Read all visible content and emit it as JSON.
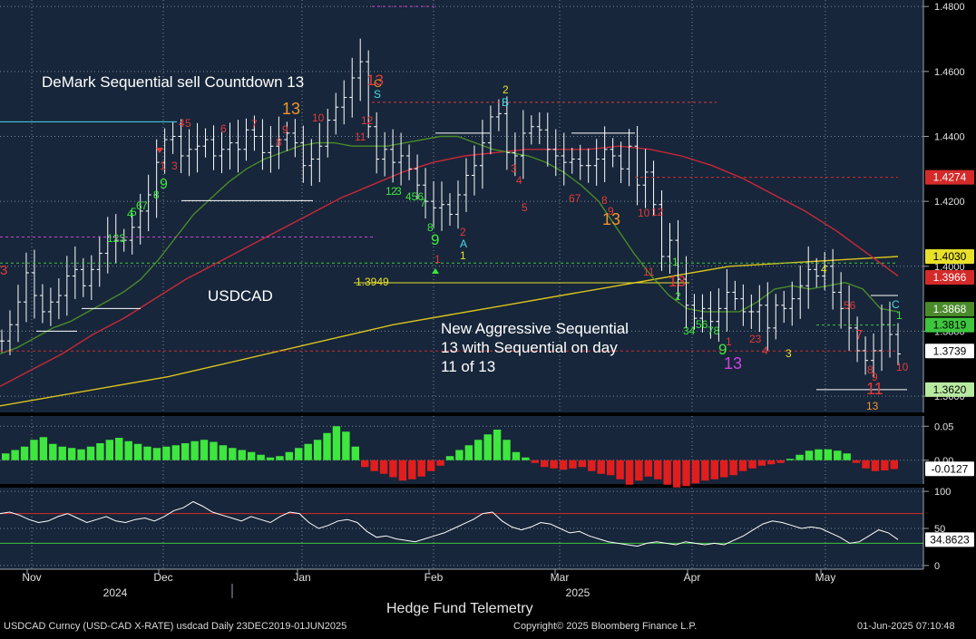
{
  "chart_data": {
    "type": "line",
    "title": "USDCAD",
    "security": "USDCAD",
    "period": "Daily",
    "x_labels": [
      "Nov",
      "Dec",
      "Jan",
      "Feb",
      "Mar",
      "Apr",
      "May"
    ],
    "year_labels": [
      "2024",
      "2025"
    ],
    "price_panel": {
      "ylim": [
        1.355,
        1.482
      ],
      "y_ticks": [
        "1.4800",
        "1.4600",
        "1.4400",
        "1.4200",
        "1.4000",
        "1.3800",
        "1.3600"
      ],
      "close": [
        1.377,
        1.382,
        1.389,
        1.398,
        1.391,
        1.386,
        1.389,
        1.391,
        1.397,
        1.399,
        1.394,
        1.399,
        1.404,
        1.409,
        1.408,
        1.408,
        1.412,
        1.417,
        1.422,
        1.432,
        1.439,
        1.44,
        1.434,
        1.436,
        1.437,
        1.439,
        1.434,
        1.436,
        1.438,
        1.436,
        1.442,
        1.44,
        1.435,
        1.437,
        1.439,
        1.441,
        1.438,
        1.431,
        1.433,
        1.437,
        1.445,
        1.449,
        1.452,
        1.458,
        1.463,
        1.443,
        1.433,
        1.436,
        1.432,
        1.434,
        1.43,
        1.425,
        1.42,
        1.418,
        1.419,
        1.416,
        1.422,
        1.428,
        1.431,
        1.438,
        1.446,
        1.447,
        1.435,
        1.434,
        1.441,
        1.443,
        1.442,
        1.436,
        1.434,
        1.432,
        1.433,
        1.431,
        1.431,
        1.433,
        1.436,
        1.434,
        1.43,
        1.437,
        1.425,
        1.429,
        1.419,
        1.403,
        1.408,
        1.396,
        1.388,
        1.384,
        1.387,
        1.383,
        1.387,
        1.392,
        1.39,
        1.386,
        1.386,
        1.388,
        1.381,
        1.388,
        1.387,
        1.39,
        1.394,
        1.399,
        1.397,
        1.4,
        1.392,
        1.387,
        1.381,
        1.374,
        1.371,
        1.374,
        1.382,
        1.379,
        1.373
      ],
      "ma_fast": [
        1.373,
        1.375,
        1.378,
        1.381,
        1.383,
        1.386,
        1.389,
        1.392,
        1.396,
        1.402,
        1.409,
        1.416,
        1.421,
        1.426,
        1.43,
        1.433,
        1.435,
        1.437,
        1.438,
        1.438,
        1.437,
        1.437,
        1.437,
        1.438,
        1.439,
        1.44,
        1.44,
        1.438,
        1.436,
        1.435,
        1.434,
        1.432,
        1.429,
        1.425,
        1.42,
        1.412,
        1.404,
        1.397,
        1.391,
        1.387,
        1.386,
        1.386,
        1.386,
        1.389,
        1.393,
        1.394,
        1.393,
        1.394,
        1.395,
        1.393,
        1.387,
        1.386
      ],
      "ma_mid": [
        1.363,
        1.368,
        1.373,
        1.379,
        1.384,
        1.39,
        1.396,
        1.401,
        1.406,
        1.411,
        1.416,
        1.421,
        1.425,
        1.429,
        1.432,
        1.434,
        1.435,
        1.436,
        1.436,
        1.436,
        1.437,
        1.436,
        1.434,
        1.431,
        1.427,
        1.422,
        1.417,
        1.411,
        1.404,
        1.397
      ],
      "ma_slow": [
        1.357,
        1.36,
        1.363,
        1.366,
        1.37,
        1.374,
        1.378,
        1.382,
        1.385,
        1.388,
        1.391,
        1.394,
        1.397,
        1.4,
        1.401,
        1.402,
        1.403
      ],
      "price_labels": [
        {
          "text": "1.4274",
          "value": 1.4274,
          "color": "#d42a2a"
        },
        {
          "text": "1.4030",
          "value": 1.403,
          "color": "#e8e02a"
        },
        {
          "text": "1.3966",
          "value": 1.3966,
          "color": "#d42a2a"
        },
        {
          "text": "1.3868",
          "value": 1.3868,
          "color": "#4a8a2a"
        },
        {
          "text": "1.3819",
          "value": 1.3819,
          "color": "#3ec63e"
        },
        {
          "text": "1.3739",
          "value": 1.3739,
          "color": "#ffffff"
        },
        {
          "text": "1.3620",
          "value": 1.362,
          "color": "#b7eaa0"
        }
      ],
      "level_note": "1.3949"
    },
    "momentum_panel": {
      "ylim": [
        -0.035,
        0.065
      ],
      "y_ticks": [
        "0.05",
        "0.00"
      ],
      "last_label": "-0.0127",
      "values": [
        0.01,
        0.015,
        0.02,
        0.03,
        0.034,
        0.024,
        0.02,
        0.018,
        0.016,
        0.02,
        0.025,
        0.03,
        0.033,
        0.028,
        0.024,
        0.02,
        0.018,
        0.02,
        0.022,
        0.025,
        0.028,
        0.03,
        0.027,
        0.022,
        0.018,
        0.015,
        0.012,
        0.008,
        0.004,
        0.006,
        0.012,
        0.018,
        0.024,
        0.03,
        0.04,
        0.05,
        0.042,
        0.02,
        -0.01,
        -0.016,
        -0.02,
        -0.025,
        -0.03,
        -0.028,
        -0.024,
        -0.016,
        -0.008,
        0.006,
        0.015,
        0.022,
        0.03,
        0.038,
        0.045,
        0.03,
        0.012,
        0.004,
        -0.004,
        -0.01,
        -0.012,
        -0.014,
        -0.012,
        -0.01,
        -0.016,
        -0.02,
        -0.022,
        -0.028,
        -0.036,
        -0.03,
        -0.024,
        -0.028,
        -0.036,
        -0.04,
        -0.038,
        -0.034,
        -0.03,
        -0.028,
        -0.025,
        -0.022,
        -0.016,
        -0.012,
        -0.008,
        -0.006,
        -0.004,
        0.002,
        0.008,
        0.014,
        0.016,
        0.016,
        0.014,
        0.01,
        -0.004,
        -0.012,
        -0.016,
        -0.015,
        -0.013
      ]
    },
    "oscillator_panel": {
      "ylim": [
        -5,
        105
      ],
      "y_ticks": [
        "100",
        "50",
        "0"
      ],
      "last_label": "34.8623",
      "overbought": 70,
      "oversold": 30,
      "values": [
        70,
        72,
        68,
        62,
        58,
        60,
        66,
        70,
        64,
        58,
        62,
        66,
        60,
        58,
        62,
        64,
        60,
        66,
        74,
        78,
        86,
        80,
        72,
        68,
        64,
        60,
        66,
        62,
        58,
        66,
        72,
        70,
        58,
        50,
        54,
        60,
        62,
        58,
        46,
        38,
        40,
        36,
        34,
        32,
        36,
        40,
        44,
        50,
        56,
        62,
        70,
        72,
        60,
        52,
        48,
        52,
        58,
        56,
        50,
        44,
        46,
        40,
        36,
        32,
        30,
        28,
        26,
        30,
        32,
        30,
        28,
        32,
        30,
        28,
        30,
        28,
        34,
        40,
        48,
        56,
        60,
        58,
        54,
        50,
        52,
        50,
        44,
        38,
        30,
        32,
        40,
        48,
        44,
        35
      ]
    }
  },
  "annotations": {
    "countdown_note": "DeMark Sequential sell Countdown 13",
    "symbol_label": "USDCAD",
    "aggressive_note_line1": "New Aggressive Sequential",
    "aggressive_note_line2": "13 with Sequential on day",
    "aggressive_note_line3": "11 of 13",
    "td_counts": [
      {
        "text": "3",
        "color": "#e23a3a"
      },
      {
        "text": "4",
        "color": "#e23a3a"
      },
      {
        "text": "5",
        "color": "#e23a3a"
      },
      {
        "text": "1",
        "color": "#e23a3a"
      },
      {
        "text": "3",
        "color": "#e23a3a"
      },
      {
        "text": "6",
        "color": "#e23a3a"
      },
      {
        "text": "7",
        "color": "#e23a3a"
      },
      {
        "text": "8",
        "color": "#e23a3a"
      },
      {
        "text": "9",
        "color": "#e23a3a"
      },
      {
        "text": "10",
        "color": "#e23a3a"
      },
      {
        "text": "11",
        "color": "#e23a3a"
      },
      {
        "text": "12",
        "color": "#e23a3a"
      },
      {
        "text": "13",
        "color": "#e23a3a"
      },
      {
        "text": "13",
        "color": "#f0962a"
      },
      {
        "text": "9",
        "color": "#3ee63e"
      },
      {
        "text": "8",
        "color": "#3ee63e"
      },
      {
        "text": "7",
        "color": "#3ee63e"
      },
      {
        "text": "6",
        "color": "#3ee63e"
      },
      {
        "text": "5",
        "color": "#3ee63e"
      },
      {
        "text": "4",
        "color": "#3ee63e"
      },
      {
        "text": "123",
        "color": "#3ee63e"
      },
      {
        "text": "1",
        "color": "#3ee63e"
      },
      {
        "text": "2",
        "color": "#3ee63e"
      },
      {
        "text": "3",
        "color": "#3ee63e"
      },
      {
        "text": "456",
        "color": "#3ee63e"
      },
      {
        "text": "7",
        "color": "#3ee63e"
      },
      {
        "text": "8",
        "color": "#3ee63e"
      },
      {
        "text": "9",
        "color": "#3ee63e"
      },
      {
        "text": "1",
        "color": "#e23a3a"
      },
      {
        "text": "2",
        "color": "#e23a3a"
      },
      {
        "text": "A",
        "color": "#4ad8e8"
      },
      {
        "text": "1",
        "color": "#e8e02a"
      },
      {
        "text": "2",
        "color": "#e8e02a"
      },
      {
        "text": "B",
        "color": "#4ad8e8"
      },
      {
        "text": "S",
        "color": "#4ad8e8"
      },
      {
        "text": "C",
        "color": "#f0962a"
      },
      {
        "text": "3",
        "color": "#e23a3a"
      },
      {
        "text": "4",
        "color": "#e23a3a"
      },
      {
        "text": "5",
        "color": "#e23a3a"
      },
      {
        "text": "67",
        "color": "#e23a3a"
      },
      {
        "text": "8",
        "color": "#e23a3a"
      },
      {
        "text": "9",
        "color": "#e23a3a"
      },
      {
        "text": "10",
        "color": "#e23a3a"
      },
      {
        "text": "13",
        "color": "#f0962a"
      },
      {
        "text": "12",
        "color": "#e23a3a"
      },
      {
        "text": "11",
        "color": "#e23a3a"
      },
      {
        "text": "13",
        "color": "#e23a3a"
      },
      {
        "text": "1",
        "color": "#3ee63e"
      },
      {
        "text": "2",
        "color": "#3ee63e"
      },
      {
        "text": "34",
        "color": "#3ee63e"
      },
      {
        "text": "56",
        "color": "#3ee63e"
      },
      {
        "text": "78",
        "color": "#3ee63e"
      },
      {
        "text": "9",
        "color": "#3ee63e"
      },
      {
        "text": "13",
        "color": "#cc44dd"
      },
      {
        "text": "1",
        "color": "#e23a3a"
      },
      {
        "text": "23",
        "color": "#e23a3a"
      },
      {
        "text": "4",
        "color": "#e23a3a"
      },
      {
        "text": "3",
        "color": "#e8e02a"
      },
      {
        "text": "4",
        "color": "#e8e02a"
      },
      {
        "text": "56",
        "color": "#e23a3a"
      },
      {
        "text": "7",
        "color": "#e23a3a"
      },
      {
        "text": "8",
        "color": "#e23a3a"
      },
      {
        "text": "9",
        "color": "#e23a3a"
      },
      {
        "text": "10",
        "color": "#e23a3a"
      },
      {
        "text": "11",
        "color": "#e23a3a"
      },
      {
        "text": "13",
        "color": "#f0962a"
      },
      {
        "text": "C",
        "color": "#4ad8e8"
      },
      {
        "text": "1",
        "color": "#3ee63e"
      },
      {
        "text": "2",
        "color": "#3ee63e"
      }
    ]
  },
  "footer": {
    "center": "Hedge Fund Telemetry",
    "security": "USDCAD Curncy (USD-CAD X-RATE) usdcad  Daily 23DEC2019-01JUN2025",
    "copyright": "Copyright© 2025 Bloomberg Finance L.P.",
    "timestamp": "01-Jun-2025 07:10:48"
  },
  "colors": {
    "background": "#17263a",
    "price_bar": "#ffffff",
    "ma_fast": "#4a8a2a",
    "ma_mid": "#c8283a",
    "ma_slow": "#d8c21e",
    "momentum_up": "#3ee63e",
    "momentum_down": "#e01e1e",
    "oscillator": "#ffffff",
    "overbought": "#d42a2a",
    "oversold": "#3ec63e"
  }
}
